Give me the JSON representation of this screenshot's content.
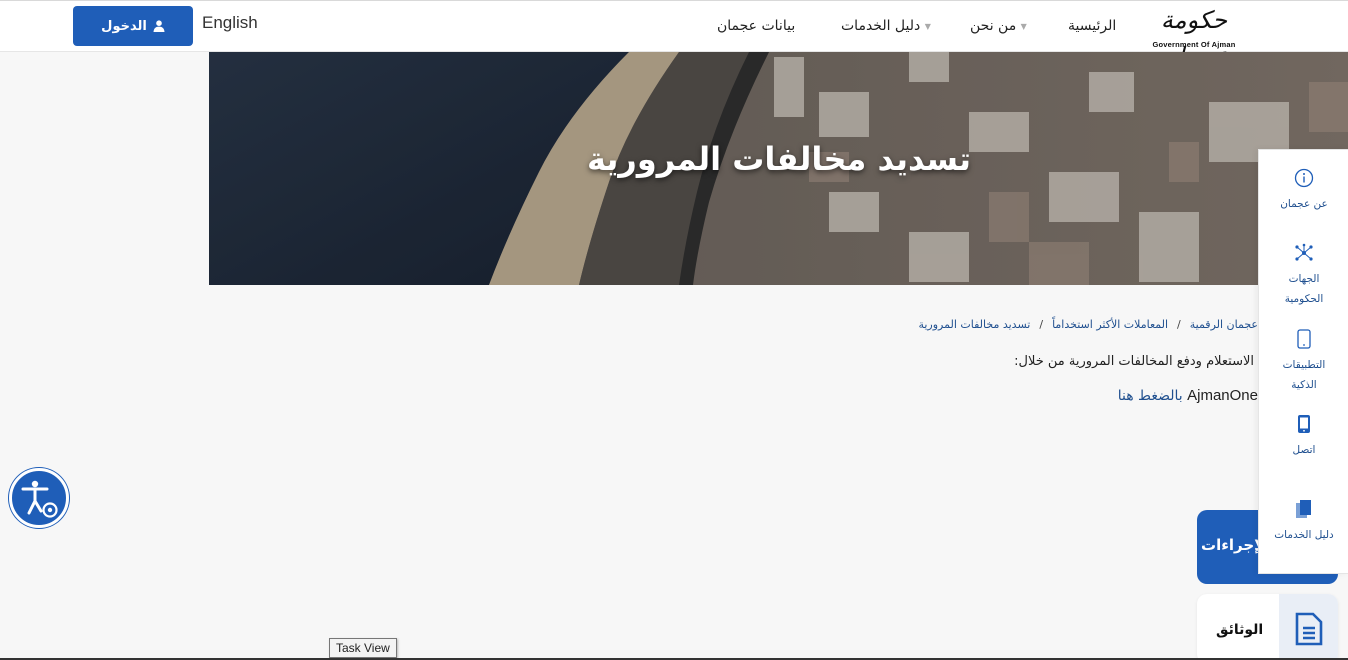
{
  "header": {
    "login_label": "الدخول",
    "language_label": "English",
    "nav": [
      {
        "label": "الرئيسية"
      },
      {
        "label": "من نحن"
      },
      {
        "label": "دليل الخدمات"
      },
      {
        "label": "بيانات عجمان"
      }
    ],
    "logo": {
      "arabic": "حكومة عجمان",
      "english": "Government Of Ajman"
    }
  },
  "hero": {
    "title": "تسديد مخالفات المرورية"
  },
  "breadcrumb": [
    "عجمان الرقمية",
    "المعاملات الأكثر استخداماً",
    "تسديد مخالفات المرورية"
  ],
  "content": {
    "description": "الاستعلام ودفع المخالفات المرورية من خلال:",
    "link_prefix": "AjmanOne",
    "link_text": "بالضغط هنا"
  },
  "side_panel": [
    {
      "label": "عن عجمان",
      "icon": "info-icon"
    },
    {
      "label": "الجهات الحكومية",
      "icon": "network-icon"
    },
    {
      "label": "التطبيقات الذكية",
      "icon": "mobile-icon"
    },
    {
      "label": "اتصل",
      "icon": "phone-icon"
    },
    {
      "label": "دليل الخدمات",
      "icon": "copy-icon"
    }
  ],
  "cards": {
    "procedures": "الإجراءات",
    "documents": "الوثائق"
  },
  "tooltip": "Task View",
  "colors": {
    "primary": "#1f5eb8",
    "link": "#1f4f8f",
    "background": "#f7f7f7"
  }
}
